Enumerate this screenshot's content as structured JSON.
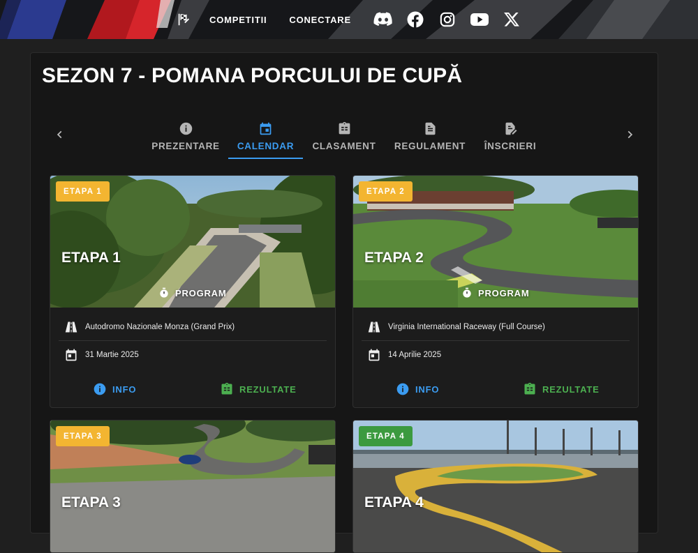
{
  "nav": {
    "brand_icon": "checkered-flag-icon",
    "links": [
      "COMPETITII",
      "CONECTARE"
    ],
    "social": [
      "discord-icon",
      "facebook-icon",
      "instagram-icon",
      "youtube-icon",
      "x-icon"
    ]
  },
  "page": {
    "title": "SEZON 7 - POMANA PORCULUI DE CUPĂ"
  },
  "tabs": [
    {
      "label": "PREZENTARE",
      "icon": "info-icon",
      "active": false
    },
    {
      "label": "CALENDAR",
      "icon": "calendar-icon",
      "active": true
    },
    {
      "label": "CLASAMENT",
      "icon": "clipboard-icon",
      "active": false
    },
    {
      "label": "REGULAMENT",
      "icon": "document-icon",
      "active": false
    },
    {
      "label": "ÎNSCRIERI",
      "icon": "edit-document-icon",
      "active": false
    }
  ],
  "colors": {
    "accent": "#3b9cf1",
    "success": "#4caf50",
    "badge_upcoming": "#f3b531",
    "badge_next": "#3c9a3f",
    "background": "#1f1f1f",
    "panel": "#161616"
  },
  "cards": [
    {
      "badge": "ETAPA 1",
      "badge_color": "yellow",
      "title": "ETAPA 1",
      "program_label": "PROGRAM",
      "track": "Autodromo Nazionale Monza (Grand Prix)",
      "date": "31 Martie 2025",
      "info_label": "INFO",
      "results_label": "REZULTATE"
    },
    {
      "badge": "ETAPA 2",
      "badge_color": "yellow",
      "title": "ETAPA 2",
      "program_label": "PROGRAM",
      "track": "Virginia International Raceway (Full Course)",
      "date": "14 Aprilie 2025",
      "info_label": "INFO",
      "results_label": "REZULTATE"
    },
    {
      "badge": "ETAPA 3",
      "badge_color": "yellow",
      "title": "ETAPA 3"
    },
    {
      "badge": "ETAPA 4",
      "badge_color": "green",
      "title": "ETAPA 4"
    }
  ]
}
